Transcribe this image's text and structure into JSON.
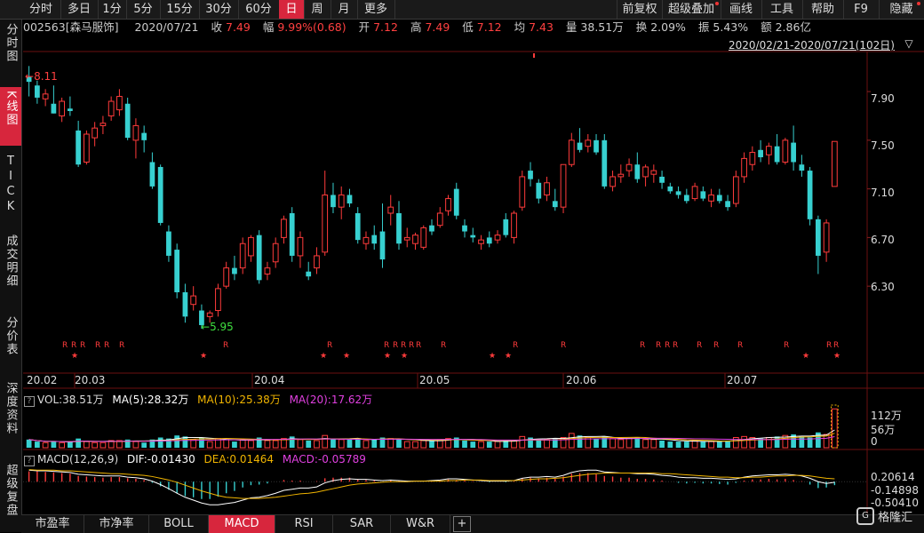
{
  "tabs": [
    "分时",
    "多日",
    "1分",
    "5分",
    "15分",
    "30分",
    "60分",
    "日",
    "周",
    "月",
    "更多"
  ],
  "active_tab": "日",
  "right_tabs": [
    "前复权",
    "超级叠加",
    "画线",
    "工具",
    "帮助",
    "F9",
    "隐藏"
  ],
  "sidebar": [
    {
      "label": "分时图",
      "active": false
    },
    {
      "label": "K线图",
      "active": true
    },
    {
      "label": "TICK",
      "active": false
    },
    {
      "label": "成交明细",
      "active": false
    },
    {
      "label": "分价表",
      "active": false
    },
    {
      "label": "深度资料",
      "active": false
    },
    {
      "label": "超级复盘",
      "active": false
    }
  ],
  "info": {
    "code": "002563[森马服饰]",
    "date": "2020/07/21",
    "close_label": "收",
    "close": "7.49",
    "amp_label": "幅",
    "amp": "9.99%(0.68)",
    "open_label": "开",
    "open": "7.12",
    "high_label": "高",
    "high": "7.49",
    "low_label": "低",
    "low": "7.12",
    "avg_label": "均",
    "avg": "7.43",
    "vol_label": "量",
    "vol": "38.51万",
    "turn_label": "换",
    "turn": "2.09%",
    "swing_label": "振",
    "swing": "5.43%",
    "amt_label": "额",
    "amt": "2.86亿"
  },
  "range": "2020/02/21-2020/07/21(102日)",
  "price_axis": [
    "7.90",
    "7.50",
    "7.10",
    "6.70",
    "6.30"
  ],
  "price_range": [
    5.6,
    8.2
  ],
  "high_mark": "8.11",
  "low_mark": "5.95",
  "dates": [
    "20.02",
    "20.03",
    "20.04",
    "20.05",
    "20.06",
    "20.07"
  ],
  "vol_label": {
    "title": "VOL:38.51万",
    "ma5": "MA(5):28.32万",
    "ma10": "MA(10):25.38万",
    "ma20": "MA(20):17.62万"
  },
  "vol_axis": [
    "112万",
    "56万",
    "0"
  ],
  "macd_label": {
    "title": "MACD(12,26,9)",
    "dif": "DIF:-0.01430",
    "dea": "DEA:0.01464",
    "macd": "MACD:-0.05789"
  },
  "macd_axis": [
    "0.20614",
    "-0.14898",
    "-0.50410"
  ],
  "bottom_tabs": [
    "市盈率",
    "市净率",
    "BOLL",
    "MACD",
    "RSI",
    "SAR",
    "W&R",
    "+"
  ],
  "active_bottom": "MACD",
  "logo": "格隆汇",
  "colors": {
    "up": "#ff3b3b",
    "down": "#37d0d0",
    "ma5": "#ffffff",
    "ma10": "#f0b400",
    "ma20": "#e040e0"
  },
  "chart_data": {
    "type": "candlestick",
    "candles": [
      [
        8.02,
        8.11,
        7.86,
        7.98
      ],
      [
        7.95,
        7.99,
        7.8,
        7.85
      ],
      [
        7.84,
        7.92,
        7.78,
        7.88
      ],
      [
        7.8,
        7.95,
        7.72,
        7.72
      ],
      [
        7.7,
        7.85,
        7.65,
        7.82
      ],
      [
        7.76,
        7.86,
        7.7,
        7.74
      ],
      [
        7.58,
        7.66,
        7.28,
        7.3
      ],
      [
        7.32,
        7.58,
        7.3,
        7.55
      ],
      [
        7.52,
        7.65,
        7.45,
        7.6
      ],
      [
        7.62,
        7.7,
        7.55,
        7.64
      ],
      [
        7.7,
        7.86,
        7.66,
        7.82
      ],
      [
        7.75,
        7.92,
        7.7,
        7.86
      ],
      [
        7.8,
        7.85,
        7.5,
        7.52
      ],
      [
        7.5,
        7.68,
        7.35,
        7.62
      ],
      [
        7.56,
        7.62,
        7.4,
        7.5
      ],
      [
        7.32,
        7.4,
        7.1,
        7.12
      ],
      [
        7.28,
        7.3,
        6.8,
        6.82
      ],
      [
        6.75,
        6.8,
        6.5,
        6.55
      ],
      [
        6.6,
        6.65,
        6.2,
        6.25
      ],
      [
        6.25,
        6.32,
        6.0,
        6.05
      ],
      [
        6.15,
        6.3,
        6.1,
        6.22
      ],
      [
        6.1,
        6.15,
        5.95,
        5.98
      ],
      [
        6.05,
        6.1,
        6.0,
        6.08
      ],
      [
        6.1,
        6.32,
        6.05,
        6.28
      ],
      [
        6.3,
        6.5,
        6.28,
        6.45
      ],
      [
        6.45,
        6.55,
        6.35,
        6.4
      ],
      [
        6.45,
        6.7,
        6.4,
        6.65
      ],
      [
        6.55,
        6.72,
        6.5,
        6.7
      ],
      [
        6.72,
        6.76,
        6.32,
        6.35
      ],
      [
        6.4,
        6.5,
        6.35,
        6.45
      ],
      [
        6.5,
        6.7,
        6.45,
        6.65
      ],
      [
        6.7,
        6.88,
        6.65,
        6.85
      ],
      [
        6.9,
        6.95,
        6.5,
        6.55
      ],
      [
        6.55,
        6.75,
        6.45,
        6.7
      ],
      [
        6.42,
        6.5,
        6.35,
        6.38
      ],
      [
        6.45,
        6.62,
        6.4,
        6.55
      ],
      [
        6.58,
        7.25,
        6.55,
        7.05
      ],
      [
        7.05,
        7.15,
        6.9,
        6.95
      ],
      [
        6.95,
        7.12,
        6.85,
        7.05
      ],
      [
        7.05,
        7.1,
        6.95,
        6.98
      ],
      [
        6.9,
        6.95,
        6.65,
        6.68
      ],
      [
        6.65,
        6.75,
        6.6,
        6.7
      ],
      [
        6.72,
        6.8,
        6.6,
        6.65
      ],
      [
        6.75,
        6.98,
        6.45,
        6.52
      ],
      [
        6.9,
        7.05,
        6.8,
        6.95
      ],
      [
        6.9,
        7.0,
        6.6,
        6.65
      ],
      [
        6.68,
        6.78,
        6.62,
        6.7
      ],
      [
        6.65,
        6.74,
        6.6,
        6.72
      ],
      [
        6.62,
        6.8,
        6.6,
        6.78
      ],
      [
        6.8,
        6.85,
        6.72,
        6.75
      ],
      [
        6.8,
        6.95,
        6.78,
        6.9
      ],
      [
        6.92,
        7.05,
        6.88,
        7.02
      ],
      [
        7.1,
        7.15,
        6.85,
        6.88
      ],
      [
        6.8,
        6.85,
        6.7,
        6.75
      ],
      [
        6.72,
        6.78,
        6.66,
        6.7
      ],
      [
        6.65,
        6.72,
        6.6,
        6.68
      ],
      [
        6.7,
        6.75,
        6.62,
        6.65
      ],
      [
        6.68,
        6.76,
        6.65,
        6.72
      ],
      [
        6.85,
        6.9,
        6.7,
        6.72
      ],
      [
        6.7,
        6.92,
        6.65,
        6.9
      ],
      [
        6.95,
        7.25,
        6.92,
        7.2
      ],
      [
        7.25,
        7.32,
        7.12,
        7.18
      ],
      [
        7.15,
        7.18,
        6.98,
        7.02
      ],
      [
        7.05,
        7.2,
        7.0,
        7.15
      ],
      [
        7.0,
        7.1,
        6.92,
        6.95
      ],
      [
        6.95,
        7.25,
        6.9,
        7.3
      ],
      [
        7.3,
        7.56,
        7.28,
        7.5
      ],
      [
        7.48,
        7.6,
        7.4,
        7.42
      ],
      [
        7.45,
        7.55,
        7.4,
        7.5
      ],
      [
        7.5,
        7.55,
        7.38,
        7.4
      ],
      [
        7.5,
        7.55,
        7.1,
        7.12
      ],
      [
        7.12,
        7.25,
        7.08,
        7.2
      ],
      [
        7.2,
        7.3,
        7.15,
        7.22
      ],
      [
        7.25,
        7.35,
        7.2,
        7.3
      ],
      [
        7.3,
        7.4,
        7.15,
        7.18
      ],
      [
        7.2,
        7.3,
        7.12,
        7.28
      ],
      [
        7.22,
        7.3,
        7.15,
        7.25
      ],
      [
        7.2,
        7.25,
        7.1,
        7.15
      ],
      [
        7.12,
        7.15,
        7.06,
        7.08
      ],
      [
        7.08,
        7.12,
        7.02,
        7.05
      ],
      [
        7.05,
        7.1,
        6.98,
        7.0
      ],
      [
        7.02,
        7.15,
        7.0,
        7.12
      ],
      [
        7.08,
        7.12,
        7.0,
        7.02
      ],
      [
        7.0,
        7.1,
        6.95,
        7.05
      ],
      [
        7.05,
        7.1,
        6.98,
        7.0
      ],
      [
        7.0,
        7.05,
        6.92,
        6.95
      ],
      [
        6.98,
        7.25,
        6.95,
        7.2
      ],
      [
        7.2,
        7.4,
        7.15,
        7.35
      ],
      [
        7.3,
        7.45,
        7.25,
        7.4
      ],
      [
        7.42,
        7.5,
        7.32,
        7.36
      ],
      [
        7.38,
        7.48,
        7.3,
        7.45
      ],
      [
        7.45,
        7.55,
        7.3,
        7.32
      ],
      [
        7.32,
        7.52,
        7.3,
        7.5
      ],
      [
        7.48,
        7.62,
        7.25,
        7.32
      ],
      [
        7.3,
        7.38,
        7.2,
        7.25
      ],
      [
        7.25,
        7.28,
        6.8,
        6.85
      ],
      [
        6.85,
        6.88,
        6.4,
        6.55
      ],
      [
        6.58,
        6.85,
        6.5,
        6.82
      ],
      [
        7.12,
        7.49,
        7.12,
        7.49
      ]
    ],
    "volumes": [
      8,
      6,
      5,
      6,
      5,
      6,
      9,
      6,
      5,
      5,
      7,
      7,
      8,
      6,
      5,
      8,
      10,
      9,
      12,
      11,
      8,
      10,
      6,
      9,
      8,
      6,
      8,
      7,
      10,
      7,
      7,
      9,
      11,
      8,
      7,
      7,
      12,
      9,
      8,
      8,
      9,
      7,
      8,
      10,
      9,
      8,
      6,
      6,
      7,
      7,
      8,
      9,
      10,
      7,
      6,
      6,
      6,
      6,
      7,
      7,
      11,
      10,
      8,
      8,
      9,
      10,
      14,
      12,
      10,
      9,
      11,
      9,
      8,
      9,
      10,
      8,
      8,
      7,
      6,
      6,
      6,
      7,
      6,
      6,
      6,
      7,
      10,
      11,
      10,
      9,
      10,
      11,
      12,
      13,
      11,
      10,
      15,
      13,
      38
    ],
    "macd": [
      0.18,
      0.18,
      0.17,
      0.16,
      0.15,
      0.14,
      0.1,
      0.09,
      0.08,
      0.07,
      0.08,
      0.08,
      0.06,
      0.05,
      0.03,
      -0.02,
      -0.08,
      -0.14,
      -0.2,
      -0.25,
      -0.27,
      -0.3,
      -0.3,
      -0.26,
      -0.2,
      -0.16,
      -0.1,
      -0.06,
      -0.05,
      -0.03,
      0.0,
      0.03,
      0.02,
      0.02,
      0.0,
      0.01,
      0.06,
      0.07,
      0.07,
      0.07,
      0.04,
      0.03,
      0.02,
      0.0,
      0.02,
      0.01,
      0.0,
      0.0,
      0.0,
      0.01,
      0.02,
      0.04,
      0.03,
      0.02,
      0.01,
      0.0,
      -0.01,
      0.0,
      -0.01,
      0.01,
      0.06,
      0.07,
      0.06,
      0.07,
      0.05,
      0.09,
      0.14,
      0.15,
      0.15,
      0.13,
      0.1,
      0.09,
      0.07,
      0.07,
      0.05,
      0.05,
      0.04,
      0.02,
      0.0,
      -0.02,
      -0.03,
      -0.02,
      -0.03,
      -0.03,
      -0.04,
      -0.05,
      -0.02,
      0.02,
      0.04,
      0.04,
      0.05,
      0.04,
      0.05,
      0.03,
      0.01,
      -0.05,
      -0.11,
      -0.1,
      -0.06
    ],
    "dif": [
      0.2,
      0.19,
      0.19,
      0.18,
      0.17,
      0.16,
      0.13,
      0.12,
      0.11,
      0.1,
      0.1,
      0.1,
      0.08,
      0.07,
      0.05,
      0.01,
      -0.05,
      -0.12,
      -0.2,
      -0.27,
      -0.32,
      -0.37,
      -0.4,
      -0.4,
      -0.38,
      -0.36,
      -0.32,
      -0.28,
      -0.27,
      -0.24,
      -0.2,
      -0.15,
      -0.13,
      -0.11,
      -0.11,
      -0.09,
      -0.02,
      0.02,
      0.04,
      0.05,
      0.04,
      0.04,
      0.03,
      0.02,
      0.03,
      0.02,
      0.01,
      0.01,
      0.01,
      0.02,
      0.03,
      0.05,
      0.05,
      0.04,
      0.03,
      0.02,
      0.01,
      0.01,
      0.01,
      0.02,
      0.06,
      0.08,
      0.08,
      0.09,
      0.08,
      0.11,
      0.16,
      0.19,
      0.2,
      0.2,
      0.17,
      0.16,
      0.15,
      0.15,
      0.14,
      0.14,
      0.13,
      0.11,
      0.1,
      0.08,
      0.07,
      0.07,
      0.06,
      0.06,
      0.05,
      0.04,
      0.05,
      0.08,
      0.1,
      0.11,
      0.12,
      0.12,
      0.13,
      0.12,
      0.1,
      0.06,
      0.0,
      -0.03,
      -0.01
    ],
    "dea": [
      0.21,
      0.2,
      0.2,
      0.2,
      0.19,
      0.19,
      0.18,
      0.17,
      0.16,
      0.15,
      0.14,
      0.14,
      0.13,
      0.12,
      0.11,
      0.09,
      0.06,
      0.03,
      -0.01,
      -0.06,
      -0.11,
      -0.16,
      -0.2,
      -0.24,
      -0.27,
      -0.28,
      -0.29,
      -0.29,
      -0.29,
      -0.28,
      -0.27,
      -0.25,
      -0.23,
      -0.21,
      -0.2,
      -0.18,
      -0.15,
      -0.12,
      -0.09,
      -0.06,
      -0.04,
      -0.03,
      -0.02,
      -0.01,
      0.0,
      0.0,
      0.0,
      0.01,
      0.01,
      0.01,
      0.01,
      0.02,
      0.02,
      0.03,
      0.03,
      0.03,
      0.02,
      0.02,
      0.02,
      0.02,
      0.03,
      0.04,
      0.05,
      0.05,
      0.06,
      0.07,
      0.09,
      0.11,
      0.13,
      0.14,
      0.15,
      0.15,
      0.15,
      0.15,
      0.15,
      0.15,
      0.15,
      0.14,
      0.14,
      0.13,
      0.12,
      0.11,
      0.1,
      0.09,
      0.08,
      0.08,
      0.07,
      0.07,
      0.08,
      0.08,
      0.09,
      0.1,
      0.1,
      0.11,
      0.11,
      0.1,
      0.08,
      0.06,
      0.05
    ]
  }
}
